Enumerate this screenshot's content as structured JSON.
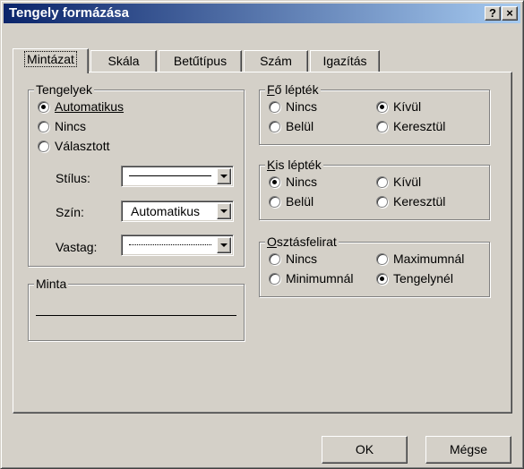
{
  "title": "Tengely formázása",
  "titlebar_buttons": {
    "help": "?",
    "close": "×"
  },
  "tabs": [
    {
      "label": "Mintázat"
    },
    {
      "label": "Skála"
    },
    {
      "label": "Betűtípus"
    },
    {
      "label": "Szám"
    },
    {
      "label": "Igazítás"
    }
  ],
  "active_tab": "Mintázat",
  "tengelyek": {
    "title": "Tengelyek",
    "options": [
      "Automatikus",
      "Nincs",
      "Választott"
    ],
    "selected": "Automatikus",
    "stilus_label": "Stílus:",
    "szin_label": "Szín:",
    "szin_value": "Automatikus",
    "vastag_label": "Vastag:"
  },
  "minta": {
    "title": "Minta"
  },
  "fo_leptek": {
    "title": "Fő lépték",
    "options": [
      "Nincs",
      "Kívül",
      "Belül",
      "Keresztül"
    ],
    "selected": "Kívül"
  },
  "kis_leptek": {
    "title": "Kis lépték",
    "options": [
      "Nincs",
      "Kívül",
      "Belül",
      "Keresztül"
    ],
    "selected": "Nincs"
  },
  "osztasfelirat": {
    "title": "Osztásfelirat",
    "options": [
      "Nincs",
      "Maximumnál",
      "Minimumnál",
      "Tengelynél"
    ],
    "selected": "Tengelynél"
  },
  "buttons": {
    "ok": "OK",
    "cancel": "Mégse"
  }
}
